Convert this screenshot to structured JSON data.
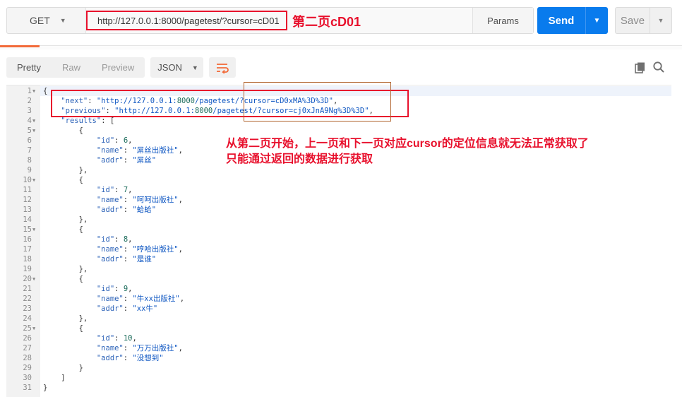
{
  "request": {
    "method": "GET",
    "url": "http://127.0.0.1:8000/pagetest/?cursor=cD01",
    "params_label": "Params",
    "send_label": "Send",
    "save_label": "Save"
  },
  "response": {
    "view_tabs": [
      "Pretty",
      "Raw",
      "Preview"
    ],
    "active_view": "Pretty",
    "format": "JSON"
  },
  "code_lines": [
    {
      "no": "1",
      "fold": true,
      "text": "{"
    },
    {
      "no": "2",
      "fold": false,
      "text": "    \"next\": \"http://127.0.0.1:8000/pagetest/?cursor=cD0xMA%3D%3D\","
    },
    {
      "no": "3",
      "fold": false,
      "text": "    \"previous\": \"http://127.0.0.1:8000/pagetest/?cursor=cj0xJnA9Ng%3D%3D\","
    },
    {
      "no": "4",
      "fold": true,
      "text": "    \"results\": ["
    },
    {
      "no": "5",
      "fold": true,
      "text": "        {"
    },
    {
      "no": "6",
      "fold": false,
      "text": "            \"id\": 6,"
    },
    {
      "no": "7",
      "fold": false,
      "text": "            \"name\": \"屌丝出版社\","
    },
    {
      "no": "8",
      "fold": false,
      "text": "            \"addr\": \"屌丝\""
    },
    {
      "no": "9",
      "fold": false,
      "text": "        },"
    },
    {
      "no": "10",
      "fold": true,
      "text": "        {"
    },
    {
      "no": "11",
      "fold": false,
      "text": "            \"id\": 7,"
    },
    {
      "no": "12",
      "fold": false,
      "text": "            \"name\": \"呵呵出版社\","
    },
    {
      "no": "13",
      "fold": false,
      "text": "            \"addr\": \"蛤蛤\""
    },
    {
      "no": "14",
      "fold": false,
      "text": "        },"
    },
    {
      "no": "15",
      "fold": true,
      "text": "        {"
    },
    {
      "no": "16",
      "fold": false,
      "text": "            \"id\": 8,"
    },
    {
      "no": "17",
      "fold": false,
      "text": "            \"name\": \"哼哈出版社\","
    },
    {
      "no": "18",
      "fold": false,
      "text": "            \"addr\": \"是谁\""
    },
    {
      "no": "19",
      "fold": false,
      "text": "        },"
    },
    {
      "no": "20",
      "fold": true,
      "text": "        {"
    },
    {
      "no": "21",
      "fold": false,
      "text": "            \"id\": 9,"
    },
    {
      "no": "22",
      "fold": false,
      "text": "            \"name\": \"牛xx出版社\","
    },
    {
      "no": "23",
      "fold": false,
      "text": "            \"addr\": \"xx牛\""
    },
    {
      "no": "24",
      "fold": false,
      "text": "        },"
    },
    {
      "no": "25",
      "fold": true,
      "text": "        {"
    },
    {
      "no": "26",
      "fold": false,
      "text": "            \"id\": 10,"
    },
    {
      "no": "27",
      "fold": false,
      "text": "            \"name\": \"万万出版社\","
    },
    {
      "no": "28",
      "fold": false,
      "text": "            \"addr\": \"没想到\""
    },
    {
      "no": "29",
      "fold": false,
      "text": "        }"
    },
    {
      "no": "30",
      "fold": false,
      "text": "    ]"
    },
    {
      "no": "31",
      "fold": false,
      "text": "}"
    }
  ],
  "annotations": {
    "title": "第二页cD01",
    "note_line1": "从第二页开始，上一页和下一页对应cursor的定位信息就无法正常获取了",
    "note_line2": "只能通过返回的数据进行获取"
  },
  "colors": {
    "send": "#097bed",
    "annotation": "#e8112d",
    "accent": "#f26b3a"
  }
}
